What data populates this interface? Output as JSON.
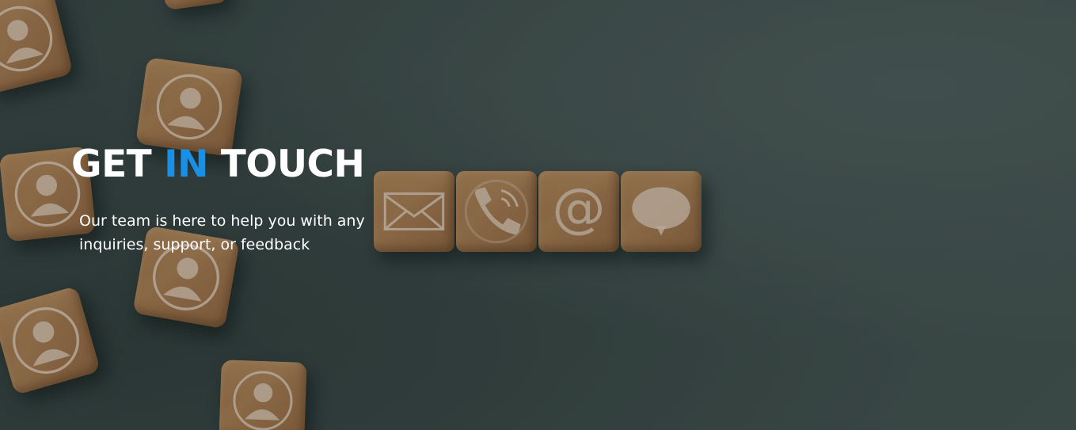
{
  "hero": {
    "title_part1": "GET ",
    "title_accent": "IN",
    "title_part2": " TOUCH",
    "subtitle": "Our team is here to help you with any inquiries, support, or feedback",
    "accent_color": "#1a8fe3"
  },
  "background": {
    "cube_icons": [
      "person-icon",
      "person-icon",
      "person-icon",
      "person-icon",
      "person-icon",
      "person-icon"
    ],
    "contact_icons": [
      "envelope-icon",
      "phone-icon",
      "at-sign-icon",
      "chat-bubble-icon"
    ],
    "at_symbol": "@"
  }
}
